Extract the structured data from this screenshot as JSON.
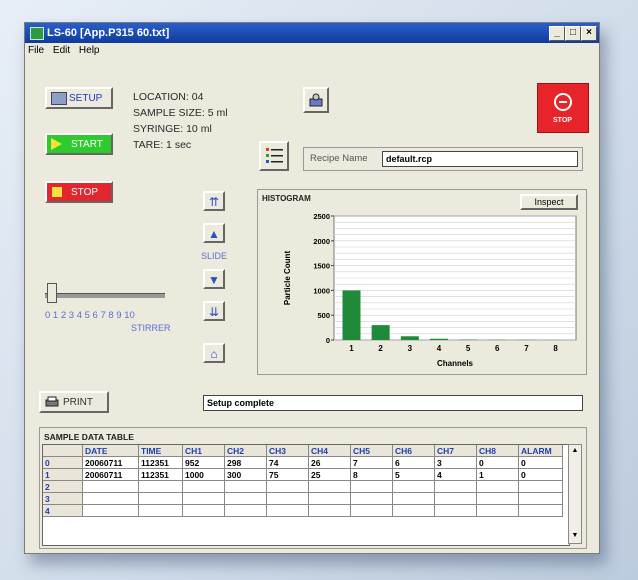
{
  "window": {
    "title": "LS-60 [App.P315 60.txt]",
    "controls": {
      "min": "_",
      "max": "□",
      "close": "×"
    }
  },
  "menu": [
    "File",
    "Edit",
    "Help"
  ],
  "buttons": {
    "setup": "SETUP",
    "start": "START",
    "stop": "STOP",
    "estop": "STOP",
    "print": "PRINT",
    "inspect": "Inspect"
  },
  "info": {
    "location": "LOCATION: 04",
    "sample_size": "SAMPLE SIZE: 5 ml",
    "syringe": "SYRINGE: 10 ml",
    "tare": "TARE: 1 sec"
  },
  "recipe": {
    "label": "Recipe Name",
    "value": "default.rcp"
  },
  "slide": {
    "label": "SLIDE"
  },
  "stirrer": {
    "label": "STIRRER",
    "ticks": "0 1 2 3 4 5 6 7 8 9 10"
  },
  "status": {
    "message": "Setup complete"
  },
  "histogram": {
    "title": "HISTOGRAM",
    "chart_data": {
      "type": "bar",
      "categories": [
        "1",
        "2",
        "3",
        "4",
        "5",
        "6",
        "7",
        "8"
      ],
      "values": [
        1000,
        300,
        75,
        25,
        8,
        5,
        4,
        1
      ],
      "xlabel": "Channels",
      "ylabel": "Particle Count",
      "ylim": [
        0,
        2500
      ],
      "yticks": [
        "0",
        "500",
        "1000",
        "1500",
        "2000",
        "2500"
      ],
      "grid": true,
      "bar_color": "#1f8a3a"
    }
  },
  "table": {
    "title": "SAMPLE DATA TABLE",
    "columns": [
      "DATE",
      "TIME",
      "CH1",
      "CH2",
      "CH3",
      "CH4",
      "CH5",
      "CH6",
      "CH7",
      "CH8",
      "ALARM"
    ],
    "row_labels": [
      "0",
      "1",
      "2",
      "3",
      "4"
    ],
    "rows": [
      [
        "20060711",
        "112351",
        "952",
        "298",
        "74",
        "26",
        "7",
        "6",
        "3",
        "0",
        "0"
      ],
      [
        "20060711",
        "112351",
        "1000",
        "300",
        "75",
        "25",
        "8",
        "5",
        "4",
        "1",
        "0"
      ]
    ]
  },
  "colors": {
    "start_green": "#1fc21f",
    "stop_red": "#e3262e",
    "title_blue": "#1a4bb8"
  }
}
